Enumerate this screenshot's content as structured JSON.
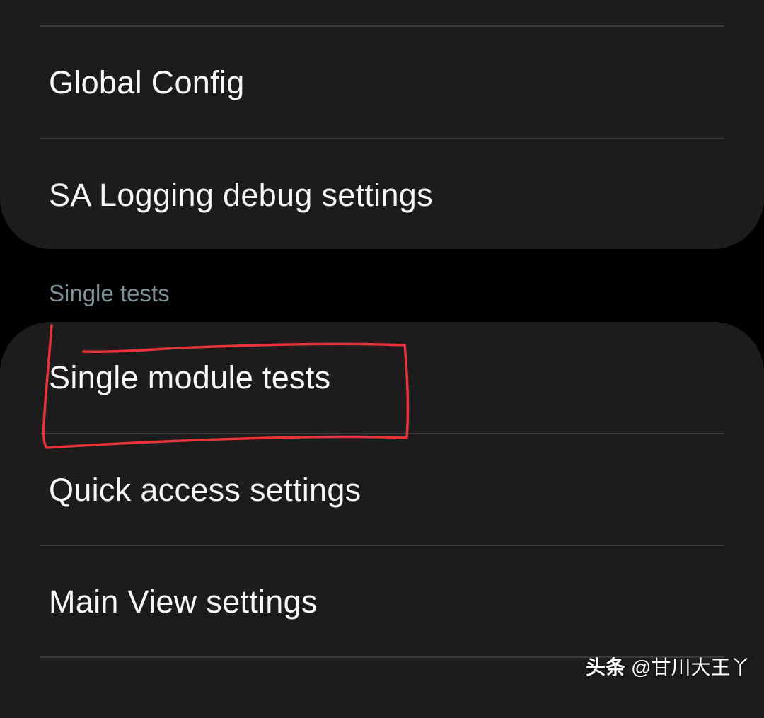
{
  "settings_group_top": {
    "items": [
      {
        "label": "Global Config"
      },
      {
        "label": "SA Logging debug settings"
      }
    ]
  },
  "section_header": "Single tests",
  "settings_group_bottom": {
    "items": [
      {
        "label": "Single module tests"
      },
      {
        "label": "Quick access settings"
      },
      {
        "label": "Main View settings"
      }
    ]
  },
  "annotation": {
    "color": "#e8333a",
    "highlighted_item": "Single module tests"
  },
  "watermark": {
    "brand": "头条",
    "handle": "@甘川大王丫"
  },
  "colors": {
    "background": "#000000",
    "card": "#1c1c1c",
    "divider": "#3a3a3a",
    "text_primary": "#f7f7f7",
    "section_header": "#7f9298"
  }
}
